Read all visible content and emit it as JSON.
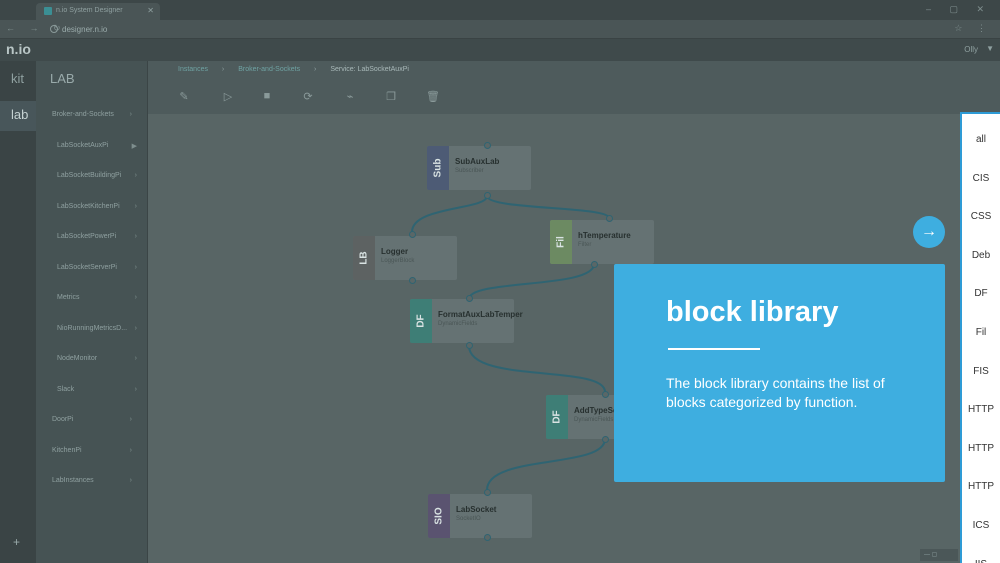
{
  "browser": {
    "tab_title": "n.io System Designer",
    "url": "designer.n.io"
  },
  "app": {
    "logo": "n.io",
    "user": "Olly"
  },
  "rail": {
    "kit": "kit",
    "lab": "lab",
    "add": "+"
  },
  "sidebar": {
    "title": "LAB",
    "items": [
      {
        "label": "Broker-and-Sockets",
        "sub": false
      },
      {
        "label": "LabSocketAuxPi",
        "sub": true
      },
      {
        "label": "LabSocketBuildingPi",
        "sub": true
      },
      {
        "label": "LabSocketKitchenPi",
        "sub": true
      },
      {
        "label": "LabSocketPowerPi",
        "sub": true
      },
      {
        "label": "LabSocketServerPi",
        "sub": true
      },
      {
        "label": "Metrics",
        "sub": true
      },
      {
        "label": "NioRunningMetricsD...",
        "sub": true
      },
      {
        "label": "NodeMonitor",
        "sub": true
      },
      {
        "label": "Slack",
        "sub": true
      },
      {
        "label": "DoorPi",
        "sub": false
      },
      {
        "label": "KitchenPi",
        "sub": false
      },
      {
        "label": "LabInstances",
        "sub": false
      }
    ]
  },
  "breadcrumb": {
    "items": [
      "Instances",
      "Broker-and-Sockets",
      "Service: LabSocketAuxPi"
    ]
  },
  "blocks": [
    {
      "tag": "Sub",
      "name": "SubAuxLab",
      "sub": "Subscriber",
      "color": "#4d5b75"
    },
    {
      "tag": "Fil",
      "name": "hTemperature",
      "sub": "Filter",
      "color": "#6c8a62"
    },
    {
      "tag": "LB",
      "name": "Logger",
      "sub": "LoggerBlock",
      "color": "#5d6262"
    },
    {
      "tag": "DF",
      "name": "FormatAuxLabTemper",
      "sub": "DynamicFields",
      "color": "#3e7e76"
    },
    {
      "tag": "DF",
      "name": "AddTypeSe",
      "sub": "DynamicFields",
      "color": "#3e7e76"
    },
    {
      "tag": "SIO",
      "name": "LabSocket",
      "sub": "SocketIO",
      "color": "#5a5370"
    }
  ],
  "categories": [
    "all",
    "CIS",
    "CSS",
    "Deb",
    "DF",
    "Fil",
    "FIS",
    "HTTP",
    "HTTP",
    "HTTP",
    "ICS",
    "IIS"
  ],
  "tour": {
    "title": "block library",
    "body": "The block library contains the list of blocks categorized by function.",
    "accent": "#3eaee0"
  }
}
